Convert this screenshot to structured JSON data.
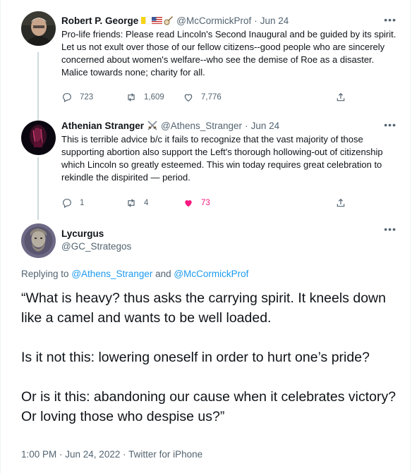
{
  "tweets": [
    {
      "name": "Robert P. George",
      "emojis": [
        "flag-vatican-icon",
        "flag-us-icon",
        "banjo-icon"
      ],
      "handle": "@McCormickProf",
      "time": "Jun 24",
      "text": "Pro-life friends: Please read Lincoln's Second Inaugural and be guided by its spirit. Let us not exult over those of our fellow citizens--good people who are sincerely concerned about women's welfare--who see the demise of Roe as a disaster. Malice towards none; charity for all.",
      "replies": "723",
      "retweets": "1,609",
      "likes": "7,776"
    },
    {
      "name": "Athenian Stranger",
      "emojis": [
        "crossed-swords-icon"
      ],
      "handle": "@Athens_Stranger",
      "time": "Jun 24",
      "text": "This is terrible advice b/c it fails to recognize that the vast majority of those supporting abortion also support the Left's thorough hollowing-out of citizenship which Lincoln so greatly esteemed. This win  today requires great celebration to rekindle the dispirited — period.",
      "replies": "1",
      "retweets": "4",
      "likes": "73"
    }
  ],
  "main_tweet": {
    "name": "Lycurgus",
    "handle": "@GC_Strategos",
    "replying_prefix": "Replying to",
    "replying_to_1": "@Athens_Stranger",
    "replying_and": "and",
    "replying_to_2": "@McCormickProf",
    "paragraphs": [
      "“What is heavy? thus asks the carrying spirit. It kneels down like a camel and wants to be well loaded.",
      "Is it not this: lowering oneself in order to hurt one’s pride?",
      "Or is it this: abandoning our cause when it celebrates victory? Or loving those who despise us?”"
    ],
    "timestamp": "1:00 PM · Jun 24, 2022 · Twitter for iPhone"
  },
  "colors": {
    "accent": "#1d9bf0",
    "like_active": "#f91880",
    "muted": "#536471"
  }
}
